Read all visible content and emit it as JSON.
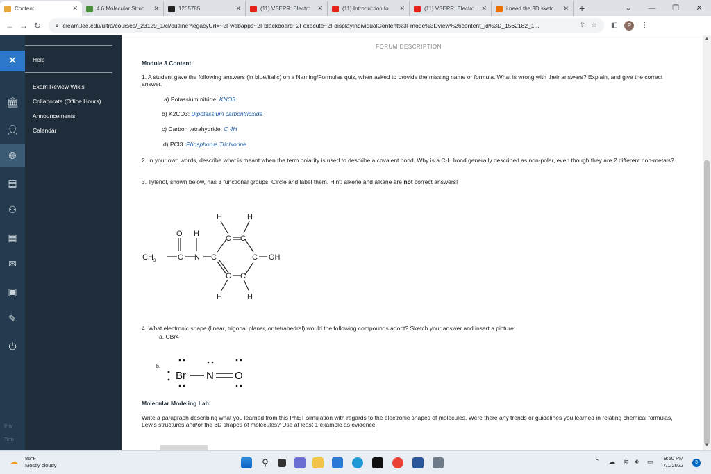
{
  "tabs": [
    {
      "title": "Content",
      "icon": "blackboard-icon",
      "color": "#e8a93a",
      "active": true
    },
    {
      "title": "4.6 Molecular Struc",
      "icon": "lines-icon",
      "color": "#4a8f3a",
      "active": false
    },
    {
      "title": "1265785",
      "icon": "bb-icon",
      "color": "#222222",
      "active": false
    },
    {
      "title": "(11) VSEPR: Electro",
      "icon": "youtube-icon",
      "color": "#e62117",
      "active": false
    },
    {
      "title": "(11) Introduction to",
      "icon": "youtube-icon",
      "color": "#e62117",
      "active": false
    },
    {
      "title": "(11) VSEPR: Electro",
      "icon": "youtube-icon",
      "color": "#e62117",
      "active": false
    },
    {
      "title": "i need the 3D sketc",
      "icon": "chegg-icon",
      "color": "#eb7100",
      "active": false
    }
  ],
  "newtab": "+",
  "address": {
    "url": "elearn.lee.edu/ultra/courses/_23129_1/cl/outline?legacyUrl=~2Fwebapps~2Fblackboard~2Fexecute~2FdisplayIndividualContent%3Fmode%3Dview%26content_id%3D_1562182_1...",
    "profile_initial": "P"
  },
  "menu": {
    "help": "Help",
    "items": [
      "Exam Review Wikis",
      "Collaborate (Office Hours)",
      "Announcements",
      "Calendar"
    ],
    "footer1": "Priv",
    "footer2": "Tern"
  },
  "content": {
    "forum_header": "FORUM DESCRIPTION",
    "module_title": "Module 3 Content:",
    "q1": "1. A student gave the following answers (in blue/italic) on a Naming/Formulas quiz, when asked to provide the missing name or formula. What is wrong with their answers? Explain, and give the correct answer.",
    "q1a_label": "a) Potassium nitride: ",
    "q1a_answer": "KNO3",
    "q1b_label": "b) K2CO3: ",
    "q1b_answer": "Dipotassium carbontrioxide",
    "q1c_label": "c) Carbon tetrahydride: ",
    "q1c_answer": "C 4H",
    "q1d_label": "d) PCl3 :",
    "q1d_answer": "Phosphorus Trichlorine",
    "q2": "2. In your own words, describe what is meant when the term polarity is used to describe a covalent bond. Why is a C-H bond generally described as non-polar, even though they are 2 different non-metals?",
    "q3_pre": "3. Tylenol, shown below, has 3 functional groups. Circle and label them. Hint: alkene and alkane are ",
    "q3_not": "not",
    "q3_post": " correct answers!",
    "q4": "4. What electronic shape (linear, trigonal planar, or tetrahedral) would the following compounds adopt? Sketch your answer and insert a picture:",
    "q4a": "a.  CBr4",
    "q4b": "b.",
    "lab_title": "Molecular Modeling Lab:",
    "lab_text": "Write a paragraph describing what you learned from this PhET simulation with regards to the electronic shapes of molecules. Were there any trends or guidelines you learned in relating chemical formulas, Lewis structures and/or the 3D shapes of molecules? ",
    "lab_link": "Use at least 1 example as evidence."
  },
  "molecule": {
    "ch3": "CH",
    "ch3_sub": "3",
    "o": "O",
    "n": "N",
    "oh": "OH",
    "carbons": [
      "C",
      "C",
      "C",
      "C",
      "C",
      "C",
      "C"
    ],
    "h": "H"
  },
  "lewis": {
    "br": "Br",
    "n": "N",
    "o": "O"
  },
  "taskbar": {
    "temp": "86°F",
    "weather": "Mostly cloudy",
    "time": "9:50 PM",
    "date": "7/1/2022",
    "notifications": "3"
  }
}
